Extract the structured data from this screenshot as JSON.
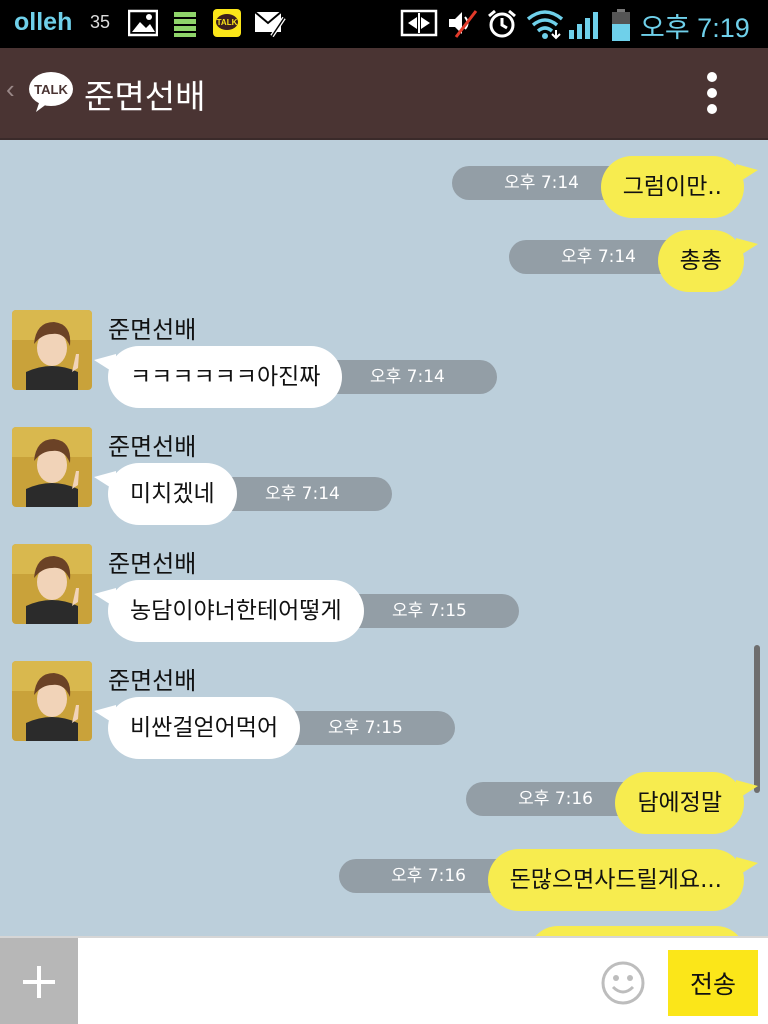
{
  "status_bar": {
    "carrier": "olleh",
    "notification_count": "35",
    "time": "오후 7:19",
    "icons": [
      "image-icon",
      "sd-card-icon",
      "kakaotalk-icon",
      "mail-clip-icon",
      "vibrate-data-icon",
      "muted-speaker-icon",
      "alarm-icon",
      "wifi-icon",
      "signal-icon",
      "battery-icon"
    ],
    "accent_color": "#6fd0ea"
  },
  "header": {
    "logo_text": "TALK",
    "title": "준면선배",
    "background": "#4a3433"
  },
  "messages": [
    {
      "id": "m1",
      "direction": "out",
      "text": "그럼이만..",
      "time": "오후 7:14"
    },
    {
      "id": "m2",
      "direction": "out",
      "text": "총총",
      "time": "오후 7:14"
    },
    {
      "id": "m3",
      "direction": "in",
      "sender": "준면선배",
      "text": "ㅋㅋㅋㅋㅋㅋ아진짜",
      "time": "오후 7:14"
    },
    {
      "id": "m4",
      "direction": "in",
      "sender": "준면선배",
      "text": "미치겠네",
      "time": "오후 7:14"
    },
    {
      "id": "m5",
      "direction": "in",
      "sender": "준면선배",
      "text": "농담이야너한테어떻게",
      "time": "오후 7:15"
    },
    {
      "id": "m6",
      "direction": "in",
      "sender": "준면선배",
      "text": "비싼걸얻어먹어",
      "time": "오후 7:15"
    },
    {
      "id": "m7",
      "direction": "out",
      "text": "담에정말",
      "time": "오후 7:16"
    },
    {
      "id": "m8",
      "direction": "out",
      "text": "돈많으면사드릴게요...",
      "time": "오후 7:16"
    }
  ],
  "input_bar": {
    "placeholder": "",
    "send_label": "전송"
  },
  "colors": {
    "chat_background": "#bccfdb",
    "outgoing_bubble": "#f7ec4f",
    "incoming_bubble": "#ffffff",
    "time_pill": "#939ea6",
    "send_button": "#fbe619"
  }
}
